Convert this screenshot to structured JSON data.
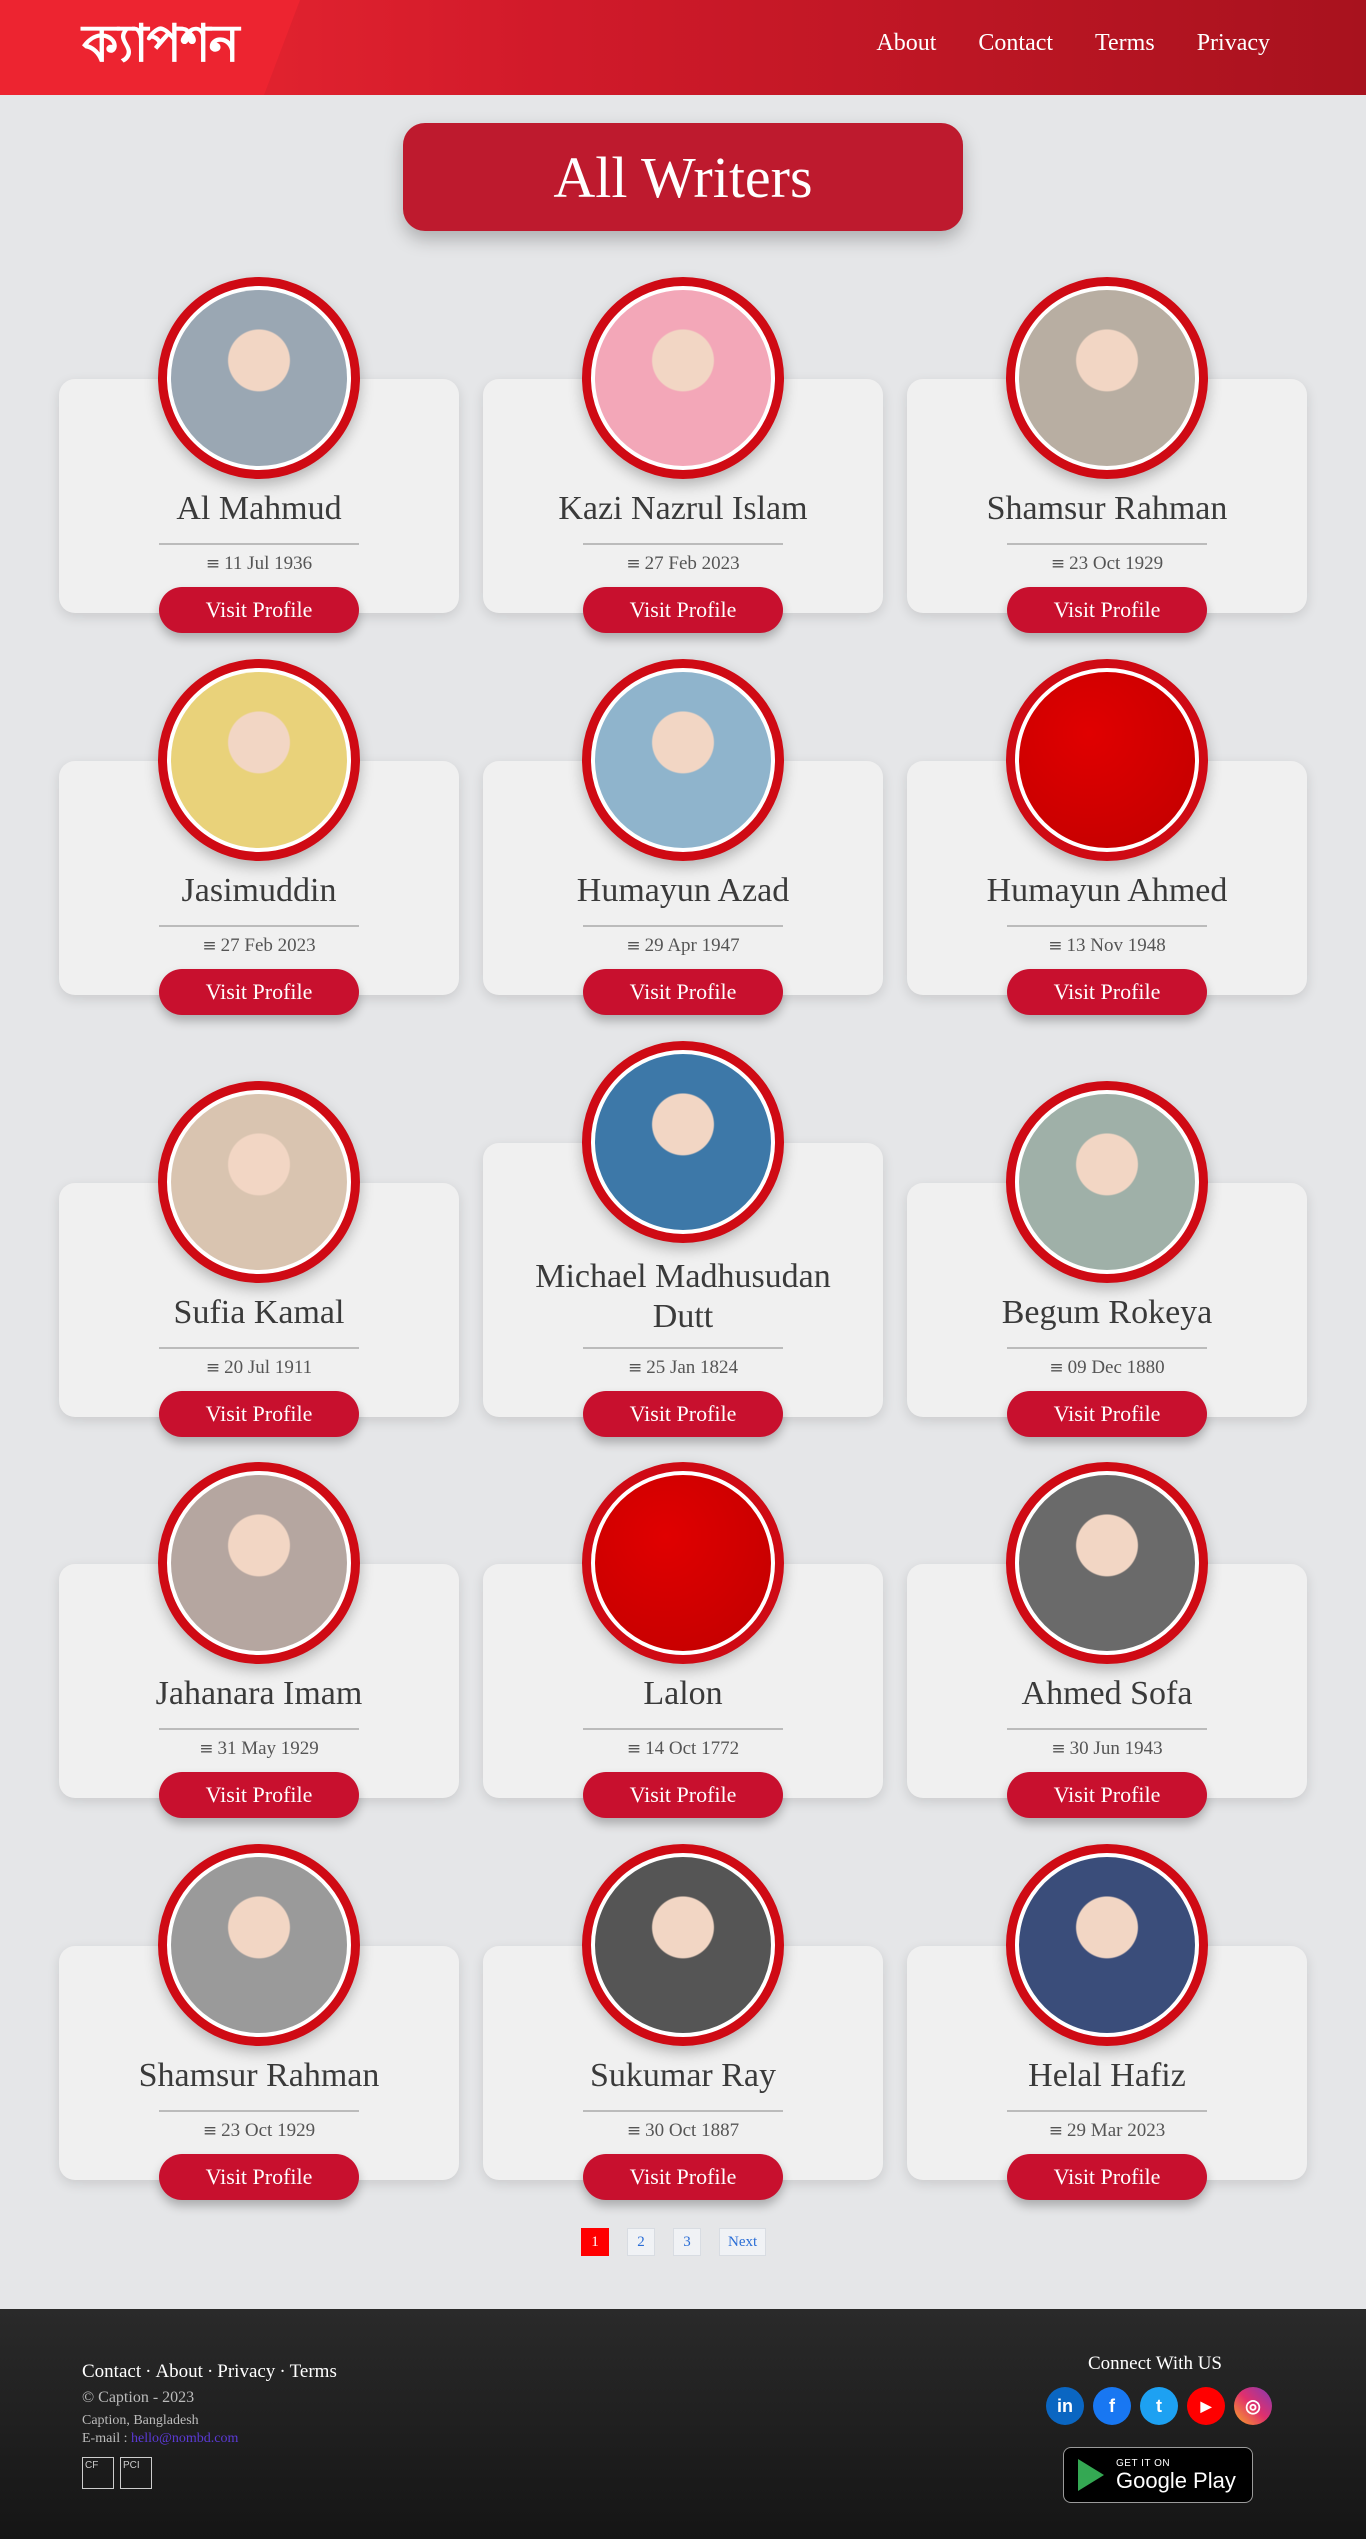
{
  "header": {
    "logo_text": "ক্যাপশন",
    "nav": [
      {
        "label": "About"
      },
      {
        "label": "Contact"
      },
      {
        "label": "Terms"
      },
      {
        "label": "Privacy"
      }
    ]
  },
  "title": "All Writers",
  "writers": [
    {
      "name": "Al Mahmud",
      "date": "11 Jul 1936",
      "visit_label": "Visit Profile",
      "photo_color": "#9aa7b3"
    },
    {
      "name": "Kazi Nazrul Islam",
      "date": "27 Feb 2023",
      "visit_label": "Visit Profile",
      "photo_color": "#f3a7b8"
    },
    {
      "name": "Shamsur Rahman",
      "date": "23 Oct 1929",
      "visit_label": "Visit Profile",
      "photo_color": "#b8aea2"
    },
    {
      "name": "Jasimuddin",
      "date": "27 Feb 2023",
      "visit_label": "Visit Profile",
      "photo_color": "#e9d27a"
    },
    {
      "name": "Humayun Azad",
      "date": "29 Apr 1947",
      "visit_label": "Visit Profile",
      "photo_color": "#8fb4cc"
    },
    {
      "name": "Humayun Ahmed",
      "date": "13 Nov 1948",
      "visit_label": "Visit Profile",
      "photo_color": "#d10000"
    },
    {
      "name": "Sufia Kamal",
      "date": "20 Jul 1911",
      "visit_label": "Visit Profile",
      "photo_color": "#d9c4b0"
    },
    {
      "name": "Michael Madhusudan Dutt",
      "date": "25 Jan 1824",
      "visit_label": "Visit Profile",
      "photo_color": "#3d78a8"
    },
    {
      "name": "Begum Rokeya",
      "date": "09 Dec 1880",
      "visit_label": "Visit Profile",
      "photo_color": "#9fb0a8"
    },
    {
      "name": "Jahanara Imam",
      "date": "31 May 1929",
      "visit_label": "Visit Profile",
      "photo_color": "#b5a6a0"
    },
    {
      "name": "Lalon",
      "date": "14 Oct 1772",
      "visit_label": "Visit Profile",
      "photo_color": "#d10000"
    },
    {
      "name": "Ahmed Sofa",
      "date": "30 Jun 1943",
      "visit_label": "Visit Profile",
      "photo_color": "#6a6a6a"
    },
    {
      "name": "Shamsur Rahman",
      "date": "23 Oct 1929",
      "visit_label": "Visit Profile",
      "photo_color": "#9a9a9a"
    },
    {
      "name": "Sukumar Ray",
      "date": "30 Oct 1887",
      "visit_label": "Visit Profile",
      "photo_color": "#555555"
    },
    {
      "name": "Helal Hafiz",
      "date": "29 Mar 2023",
      "visit_label": "Visit Profile",
      "photo_color": "#3a4d7a"
    }
  ],
  "pagination": {
    "pages": [
      "1",
      "2",
      "3"
    ],
    "active": "1",
    "next_label": "Next"
  },
  "footer": {
    "links": [
      "Contact",
      "About",
      "Privacy",
      "Terms"
    ],
    "copyright": "© Caption - 2023",
    "address": "Caption, Bangladesh",
    "email_label": "E-mail : ",
    "email": "hello@nombd.com",
    "badges": [
      "CF",
      "PCI"
    ],
    "connect_label": "Connect With US",
    "socials": [
      {
        "name": "linkedin",
        "glyph": "in",
        "color": "#0a66c2"
      },
      {
        "name": "facebook",
        "glyph": "f",
        "color": "#1877f2"
      },
      {
        "name": "twitter",
        "glyph": "t",
        "color": "#1da1f2"
      },
      {
        "name": "youtube",
        "glyph": "▶",
        "color": "#ff0000"
      },
      {
        "name": "instagram",
        "glyph": "◎",
        "color": "#d6249f"
      }
    ],
    "gplay_small": "GET IT ON",
    "gplay_big": "Google Play"
  }
}
